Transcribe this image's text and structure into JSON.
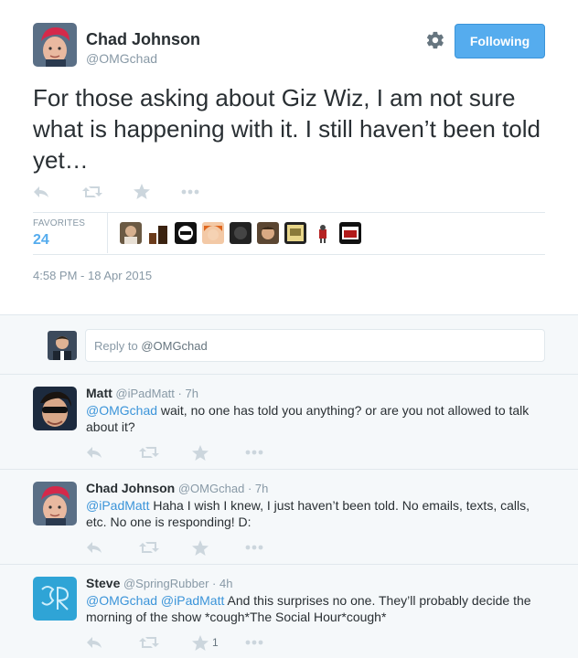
{
  "tweet": {
    "author_name": "Chad Johnson",
    "author_handle": "@OMGchad",
    "follow_label": "Following",
    "text": "For those asking about Giz Wiz, I am not sure what is happening with it. I still haven’t been told yet…",
    "favorites_label": "FAVORITES",
    "favorites_count": "24",
    "timestamp": "4:58 PM - 18 Apr 2015",
    "icons": [
      "reply-icon",
      "retweet-icon",
      "favorite-icon",
      "more-icon",
      "gear-icon"
    ]
  },
  "reply_box": {
    "prefix": "Reply to ",
    "handle": "@OMGchad"
  },
  "replies": [
    {
      "name": "Matt",
      "handle": "@iPadMatt",
      "time": "· 7h",
      "mention": "@OMGchad",
      "text": " wait, no one has told you anything? or are you not allowed to talk about it?",
      "fav_count": ""
    },
    {
      "name": "Chad Johnson",
      "handle": "@OMGchad",
      "time": "· 7h",
      "mention": "@iPadMatt",
      "text": " Haha I wish I knew, I just haven’t been told. No emails, texts, calls, etc. No one is responding! D:",
      "fav_count": ""
    },
    {
      "name": "Steve",
      "handle": "@SpringRubber",
      "time": "· 4h",
      "mention": "@OMGchad",
      "mention2": "@iPadMatt",
      "text": " And this surprises no one. They’ll probably decide the morning of the show *cough*The Social Hour*cough*",
      "fav_count": "1"
    }
  ],
  "colors": {
    "accent": "#55acee",
    "link": "#3b94d9",
    "muted": "#8899a6",
    "icon": "#ccd6dd"
  }
}
